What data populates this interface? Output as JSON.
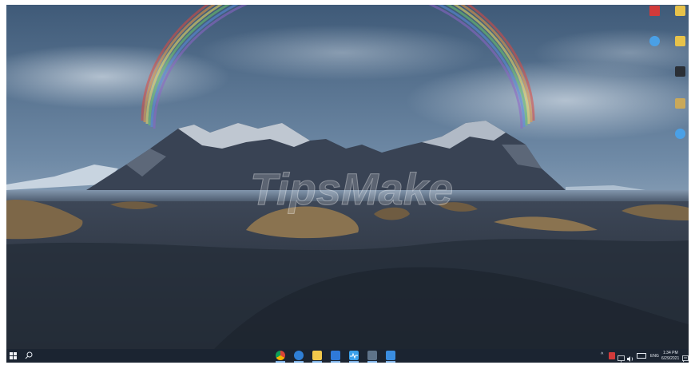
{
  "desktop": {
    "wallpaper_watermark": "TipsMake",
    "icons": [
      {
        "name": "recycle-bin-icon",
        "caption": "",
        "color": "#d23a3a"
      },
      {
        "name": "folder-icon",
        "caption": "",
        "color": "#e7c24a"
      },
      {
        "name": "edge-icon",
        "caption": "",
        "color": "#4aa0e6"
      },
      {
        "name": "folder-icon",
        "caption": "",
        "color": "#e7c24a"
      },
      {
        "name": "app-icon",
        "caption": "",
        "color": "#2a2f36"
      },
      {
        "name": "app-icon",
        "caption": "",
        "color": "#c9a85a"
      },
      {
        "name": "edge-icon",
        "caption": "",
        "color": "#4aa0e6"
      }
    ]
  },
  "taskbar": {
    "start_icon": "windows-logo-icon",
    "search_icon": "search-icon",
    "apps": [
      {
        "name": "chrome-icon",
        "color": "#e9b62b"
      },
      {
        "name": "security-icon",
        "color": "#2f7fd6"
      },
      {
        "name": "file-explorer-icon",
        "color": "#f2c84b"
      },
      {
        "name": "calendar-icon",
        "color": "#2f79d9"
      },
      {
        "name": "performance-icon",
        "color": "#39a0ea"
      },
      {
        "name": "calculator-icon",
        "color": "#5e7389"
      },
      {
        "name": "photos-icon",
        "color": "#3a8de0"
      }
    ],
    "tray": {
      "chevron": "^",
      "language": "ENG",
      "time": "1:34 PM",
      "date": "6/29/2021"
    }
  }
}
